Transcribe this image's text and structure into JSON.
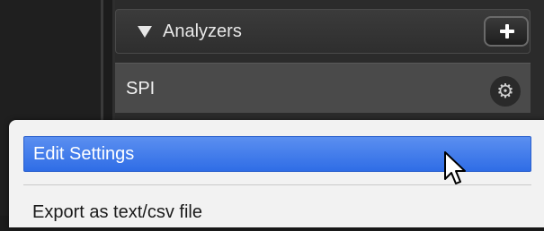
{
  "analyzers_panel": {
    "title": "Analyzers",
    "add_button_label": "+",
    "items": [
      {
        "label": "SPI",
        "settings_icon": "gear-icon"
      }
    ]
  },
  "context_menu": {
    "items": [
      {
        "label": "Edit Settings",
        "selected": true
      },
      {
        "label": "Export as text/csv file",
        "selected": false
      }
    ]
  },
  "colors": {
    "selection": "#3a78ea",
    "menu_background": "#f2f2f2",
    "panel_background": "#2b2b2b"
  }
}
